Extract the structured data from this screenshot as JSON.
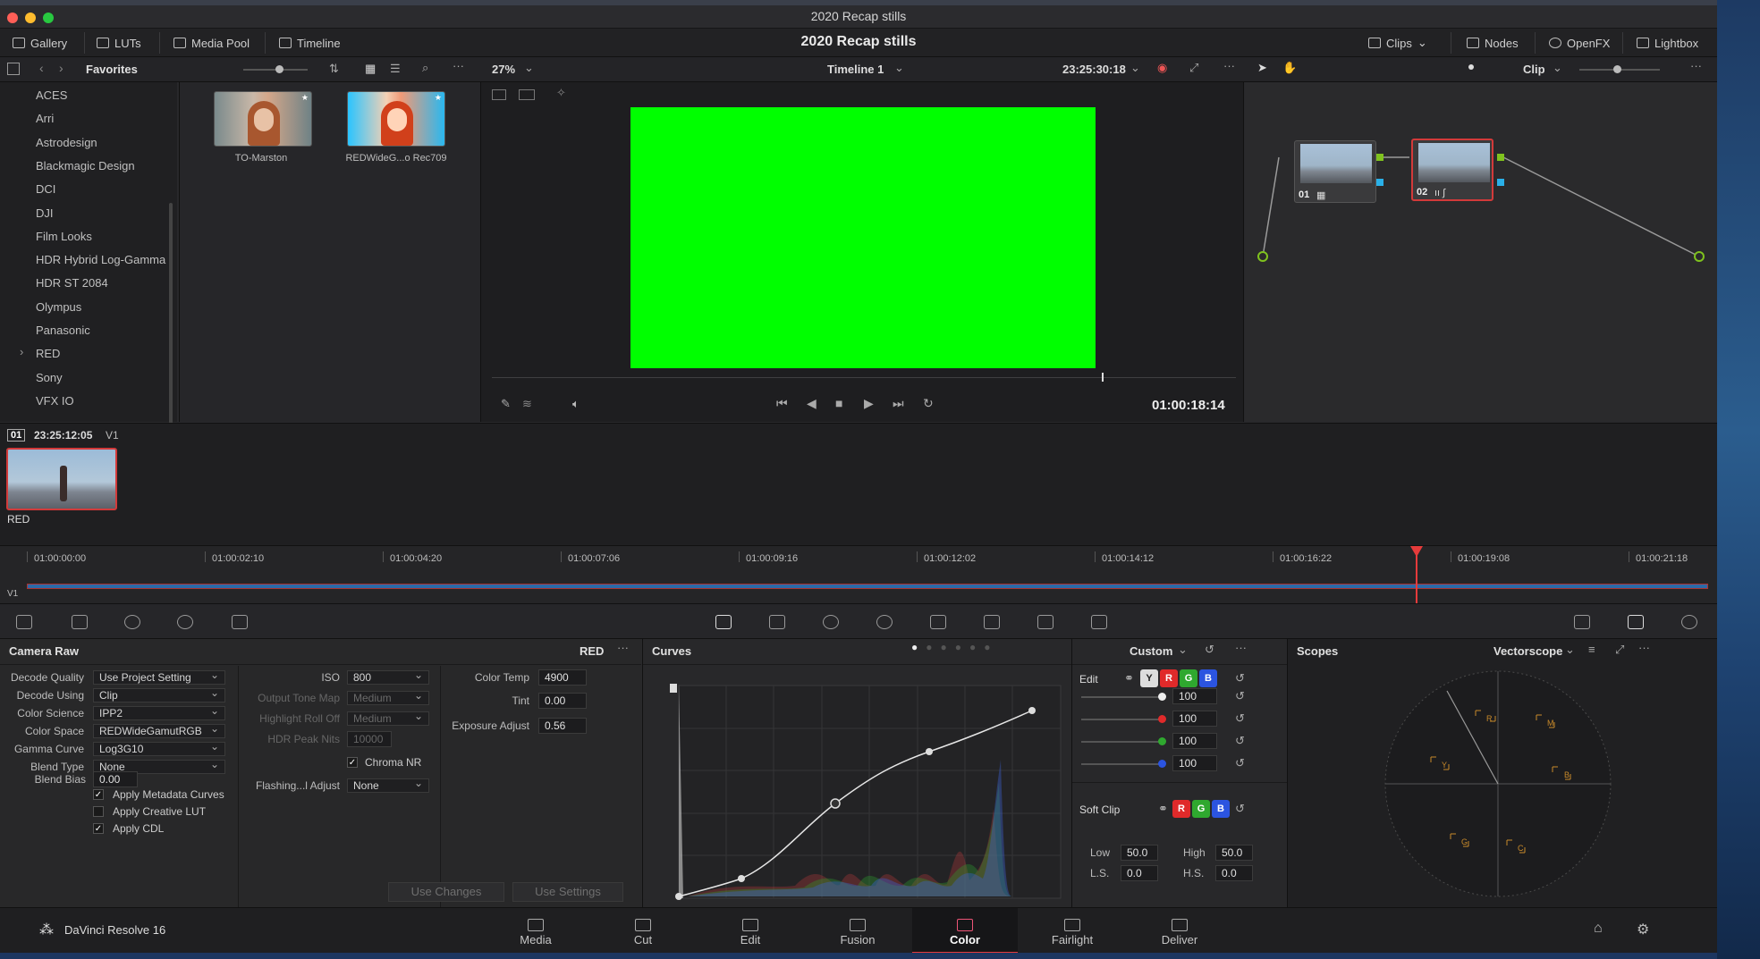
{
  "window": {
    "title": "2020 Recap stills"
  },
  "topbar": {
    "gallery": "Gallery",
    "luts": "LUTs",
    "media_pool": "Media Pool",
    "timeline": "Timeline",
    "project_title": "2020 Recap stills",
    "clips": "Clips",
    "nodes": "Nodes",
    "openfx": "OpenFX",
    "lightbox": "Lightbox"
  },
  "luts_panel": {
    "header": "Favorites",
    "items": [
      "ACES",
      "Arri",
      "Astrodesign",
      "Blackmagic Design",
      "DCI",
      "DJI",
      "Film Looks",
      "HDR Hybrid Log-Gamma",
      "HDR ST 2084",
      "Olympus",
      "Panasonic",
      "RED",
      "Sony",
      "VFX IO"
    ],
    "thumbs": [
      {
        "caption": "TO-Marston"
      },
      {
        "caption": "REDWideG...o Rec709"
      }
    ]
  },
  "viewer": {
    "zoom": "27%",
    "timeline_name": "Timeline 1",
    "source_tc": "23:25:30:18",
    "record_tc": "01:00:18:14",
    "frame_color": "#00ff00"
  },
  "nodes": {
    "mode": "Clip",
    "node1": "01",
    "node2": "02"
  },
  "clip_strip": {
    "clip_num": "01",
    "clip_tc": "23:25:12:05",
    "track": "V1",
    "clip_label": "RED"
  },
  "ruler": {
    "ticks": [
      "01:00:00:00",
      "01:00:02:10",
      "01:00:04:20",
      "01:00:07:06",
      "01:00:09:16",
      "01:00:12:02",
      "01:00:14:12",
      "01:00:16:22",
      "01:00:19:08",
      "01:00:21:18"
    ],
    "track": "V1",
    "playhead_color": "#e63b3b"
  },
  "camera_raw": {
    "title": "Camera Raw",
    "badge": "RED",
    "rows": [
      {
        "label": "Decode Quality",
        "value": "Use Project Setting"
      },
      {
        "label": "Decode Using",
        "value": "Clip"
      },
      {
        "label": "Color Science",
        "value": "IPP2"
      },
      {
        "label": "Color Space",
        "value": "REDWideGamutRGB"
      },
      {
        "label": "Gamma Curve",
        "value": "Log3G10"
      },
      {
        "label": "Blend Type",
        "value": "None"
      }
    ],
    "blend_bias_label": "Blend Bias",
    "blend_bias": "0.00",
    "checks": [
      {
        "label": "Apply Metadata Curves",
        "checked": true
      },
      {
        "label": "Apply Creative LUT",
        "checked": false
      },
      {
        "label": "Apply CDL",
        "checked": true
      }
    ],
    "iso_label": "ISO",
    "iso": "800",
    "tone_map_label": "Output Tone Map",
    "tone_map": "Medium",
    "rolloff_label": "Highlight Roll Off",
    "rolloff": "Medium",
    "peak_label": "HDR Peak Nits",
    "peak": "10000",
    "chroma_nr": "Chroma NR",
    "flash_label": "Flashing...l Adjust",
    "flash": "None",
    "temp_label": "Color Temp",
    "temp": "4900",
    "tint_label": "Tint",
    "tint": "0.00",
    "exposure_label": "Exposure Adjust",
    "exposure": "0.56",
    "use_changes": "Use Changes",
    "use_settings": "Use Settings"
  },
  "curves": {
    "title": "Curves",
    "mode": "Custom"
  },
  "edit_panel": {
    "edit_label": "Edit",
    "y": "Y",
    "r": "R",
    "g": "G",
    "b": "B",
    "values": [
      "100",
      "100",
      "100",
      "100"
    ],
    "soft_clip": "Soft Clip",
    "low_label": "Low",
    "low": "50.0",
    "high_label": "High",
    "high": "50.0",
    "ls_label": "L.S.",
    "ls": "0.0",
    "hs_label": "H.S.",
    "hs": "0.0",
    "colors": {
      "red": "#e02a2a",
      "green": "#2fa82f",
      "blue": "#2b54e0"
    }
  },
  "scopes": {
    "title": "Scopes",
    "mode": "Vectorscope",
    "targets": [
      "R",
      "M",
      "B",
      "C",
      "G",
      "Y"
    ]
  },
  "pages": {
    "app": "DaVinci Resolve 16",
    "items": [
      "Media",
      "Cut",
      "Edit",
      "Fusion",
      "Color",
      "Fairlight",
      "Deliver"
    ],
    "active": "Color"
  }
}
